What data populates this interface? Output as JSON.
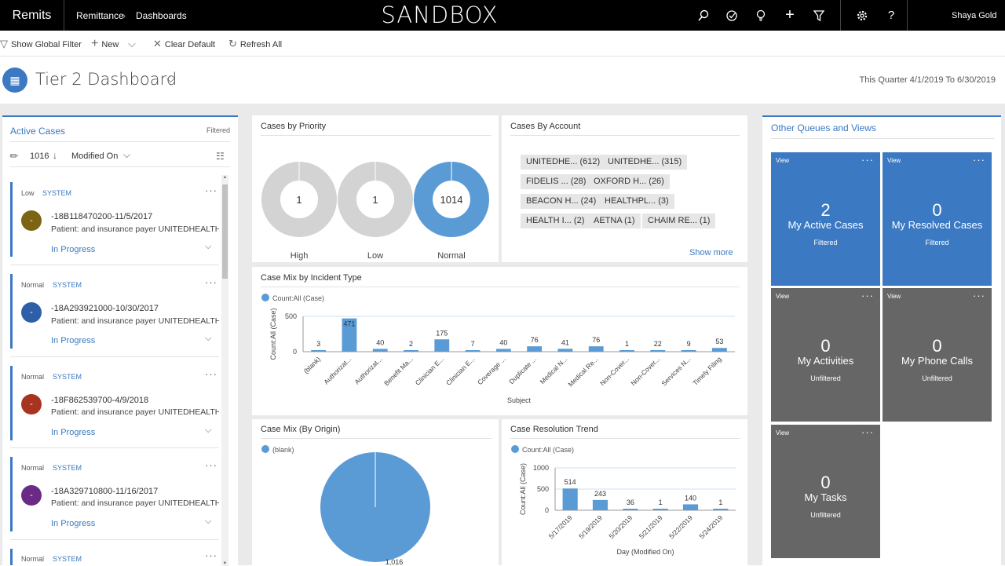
{
  "topbar": {
    "app_name": "Remits",
    "breadcrumb": [
      "Remittance",
      "Dashboards"
    ],
    "environment": "SANDBOX",
    "user": "Shaya Gold"
  },
  "commands": {
    "show_global_filter": "Show Global Filter",
    "new": "New",
    "clear_default": "Clear Default",
    "refresh_all": "Refresh All"
  },
  "dashboard": {
    "title": "Tier 2 Dashboard",
    "period": "This Quarter 4/1/2019 To 6/30/2019"
  },
  "active_cases": {
    "title": "Active Cases",
    "filter_state": "Filtered",
    "count": "1016",
    "sort_field": "Modified On",
    "items": [
      {
        "priority": "Low",
        "owner": "SYSTEM",
        "avatar_text": "-",
        "avatar_color": "#7c6414",
        "number": "-18B118470200-11/5/2017",
        "desc": "Patient: and insurance payer UNITEDHEALTHCARE",
        "status": "In Progress"
      },
      {
        "priority": "Normal",
        "owner": "SYSTEM",
        "avatar_text": "-",
        "avatar_color": "#2f5ea8",
        "number": "-18A293921000-10/30/2017",
        "desc": "Patient: and insurance payer UNITEDHEALTHCARE",
        "status": "In Progress"
      },
      {
        "priority": "Normal",
        "owner": "SYSTEM",
        "avatar_text": "-",
        "avatar_color": "#a8341f",
        "number": "-18F862539700-4/9/2018",
        "desc": "Patient: and insurance payer UNITEDHEALTHCARE",
        "status": "In Progress"
      },
      {
        "priority": "Normal",
        "owner": "SYSTEM",
        "avatar_text": "-",
        "avatar_color": "#6a2a86",
        "number": "-18A329710800-11/16/2017",
        "desc": "Patient: and insurance payer UNITEDHEALTHCARE",
        "status": "In Progress"
      },
      {
        "priority": "Normal",
        "owner": "SYSTEM"
      }
    ]
  },
  "cases_by_priority": {
    "title": "Cases by Priority",
    "items": [
      {
        "label": "High",
        "value": 1
      },
      {
        "label": "Low",
        "value": 1
      },
      {
        "label": "Normal",
        "value": 1014
      }
    ]
  },
  "cases_by_account": {
    "title": "Cases By Account",
    "tags": [
      "UNITEDHE... (612)",
      "UNITEDHE... (315)",
      "FIDELIS ... (28)",
      "OXFORD H... (26)",
      "BEACON H... (24)",
      "HEALTHPL... (3)",
      "HEALTH I... (2)",
      "AETNA (1)",
      "CHAIM RE... (1)"
    ],
    "show_more": "Show more"
  },
  "other_queues": {
    "title": "Other Queues and Views",
    "tiles": [
      {
        "view": "View",
        "count": "2",
        "label": "My Active Cases",
        "filter": "Filtered",
        "color": "#3b79c2"
      },
      {
        "view": "View",
        "count": "0",
        "label": "My Resolved Cases",
        "filter": "Filtered",
        "color": "#3b79c2"
      },
      {
        "view": "View",
        "count": "0",
        "label": "My Activities",
        "filter": "Unfiltered",
        "color": "#666666"
      },
      {
        "view": "View",
        "count": "0",
        "label": "My Phone Calls",
        "filter": "Unfiltered",
        "color": "#666666"
      },
      {
        "view": "View",
        "count": "0",
        "label": "My Tasks",
        "filter": "Unfiltered",
        "color": "#666666"
      }
    ]
  },
  "chart_data": [
    {
      "type": "pie",
      "title": "Cases by Priority",
      "categories": [
        "High",
        "Low",
        "Normal"
      ],
      "values": [
        1,
        1,
        1014
      ]
    },
    {
      "type": "bar",
      "title": "Case Mix by Incident Type",
      "legend": "Count:All (Case)",
      "xlabel": "Subject",
      "ylabel": "Count:All (Case)",
      "yticks": [
        0,
        500
      ],
      "ylim": [
        0,
        500
      ],
      "categories": [
        "(blank)",
        "Authorizat...",
        "Authorizat...",
        "Benefit Ma...",
        "Clinician E...",
        "Clinician E...",
        "Coverage ...",
        "Duplicate ...",
        "Medical N...",
        "Medical Re...",
        "Non-Cover...",
        "Non-Cover...",
        "Services N...",
        "Timely Filing"
      ],
      "values": [
        3,
        471,
        40,
        2,
        175,
        7,
        40,
        76,
        41,
        76,
        1,
        22,
        9,
        53
      ]
    },
    {
      "type": "pie",
      "title": "Case Mix (By Origin)",
      "legend": "(blank)",
      "categories": [
        "(blank)"
      ],
      "values": [
        1016
      ],
      "value_labels": [
        "1,016"
      ]
    },
    {
      "type": "bar",
      "title": "Case Resolution Trend",
      "legend": "Count:All (Case)",
      "xlabel": "Day (Modified On)",
      "ylabel": "Count:All (Case)",
      "yticks": [
        0,
        500,
        1000
      ],
      "ylim": [
        0,
        1000
      ],
      "categories": [
        "5/17/2019",
        "5/19/2019",
        "5/20/2019",
        "5/21/2019",
        "5/22/2019",
        "5/24/2019"
      ],
      "values": [
        514,
        243,
        36,
        1,
        140,
        1
      ]
    }
  ]
}
